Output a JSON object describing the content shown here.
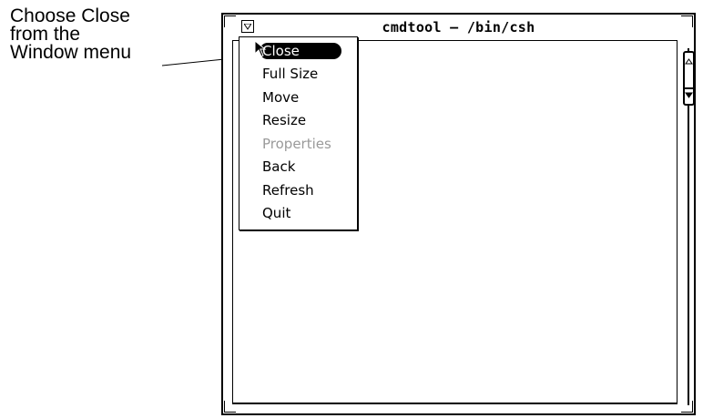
{
  "callout": {
    "lines": [
      "Choose Close",
      "from the",
      "Window menu"
    ]
  },
  "window": {
    "title": "cmdtool – /bin/csh",
    "menu_button_icon": "window-menu-triangle-icon"
  },
  "window_menu": {
    "items": [
      {
        "label": "Close",
        "state": "highlighted"
      },
      {
        "label": "Full Size",
        "state": "normal"
      },
      {
        "label": "Move",
        "state": "normal"
      },
      {
        "label": "Resize",
        "state": "normal"
      },
      {
        "label": "Properties",
        "state": "disabled"
      },
      {
        "label": "Back",
        "state": "normal"
      },
      {
        "label": "Refresh",
        "state": "normal"
      },
      {
        "label": "Quit",
        "state": "normal"
      }
    ]
  },
  "scrollbar": {
    "up_icon": "scroll-up-arrow-icon",
    "down_icon": "scroll-down-arrow-icon"
  },
  "colors": {
    "foreground": "#000000",
    "background": "#ffffff",
    "disabled_text": "#9a9a9a"
  }
}
